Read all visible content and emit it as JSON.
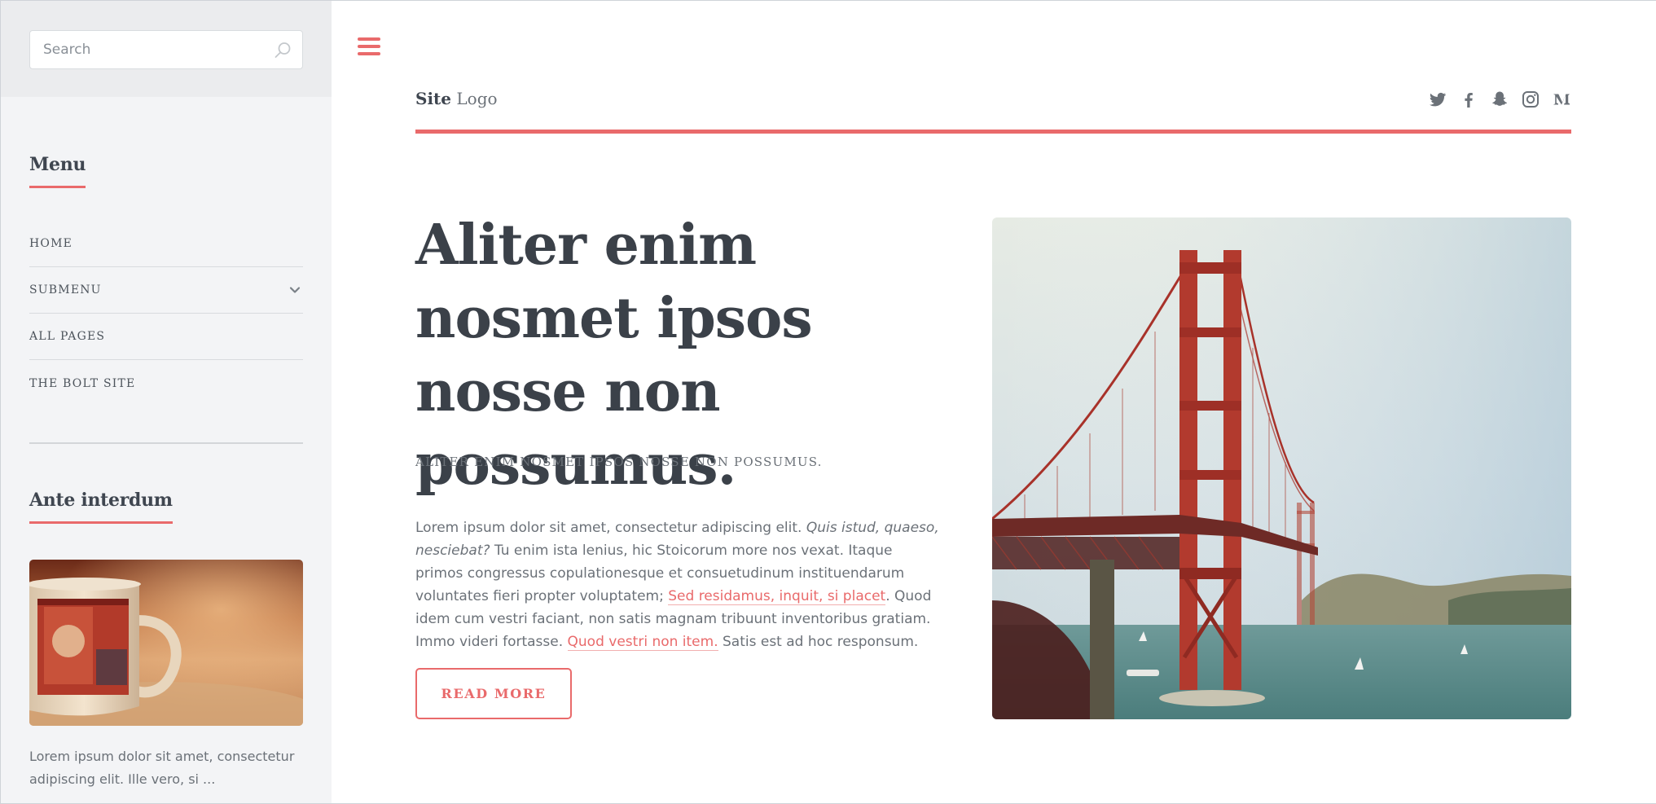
{
  "search": {
    "placeholder": "Search"
  },
  "sidebar": {
    "menu_title": "Menu",
    "items": [
      {
        "label": "HOME",
        "has_submenu": false
      },
      {
        "label": "SUBMENU",
        "has_submenu": true
      },
      {
        "label": "ALL PAGES",
        "has_submenu": false
      },
      {
        "label": "THE BOLT SITE",
        "has_submenu": false
      }
    ],
    "section_title": "Ante interdum",
    "section_text": "Lorem ipsum dolor sit amet, consectetur adipiscing elit. Ille vero, si ..."
  },
  "header": {
    "logo_bold": "Site",
    "logo_light": "Logo",
    "social_icons": [
      "twitter-icon",
      "facebook-icon",
      "snapchat-icon",
      "instagram-icon",
      "medium-icon"
    ]
  },
  "hero": {
    "title": "Aliter enim nosmet ipsos nosse non possumus.",
    "subtitle": "ALITER ENIM NOSMET IPSOS NOSSE NON POSSUMUS.",
    "body": {
      "p1": "Lorem ipsum dolor sit amet, consectetur adipiscing elit. ",
      "em1": "Quis istud, quaeso, nesciebat?",
      "p2": " Tu enim ista lenius, hic Stoicorum more nos vexat. Itaque primos congressus copulationesque et consuetudinum instituendarum voluntates fieri propter voluptatem; ",
      "link1": "Sed residamus, inquit, si placet",
      "p3": ". Quod idem cum vestri faciant, non satis magnam tribuunt inventoribus gratiam. Immo videri fortasse. ",
      "link2": "Quod vestri non item.",
      "p4": " Satis est ad hoc responsum."
    },
    "read_more": "READ MORE"
  },
  "colors": {
    "accent": "#e96a6b",
    "sidebar_bg": "#f3f4f6",
    "text_dark": "#3b4149",
    "text_muted": "#6b7178"
  }
}
